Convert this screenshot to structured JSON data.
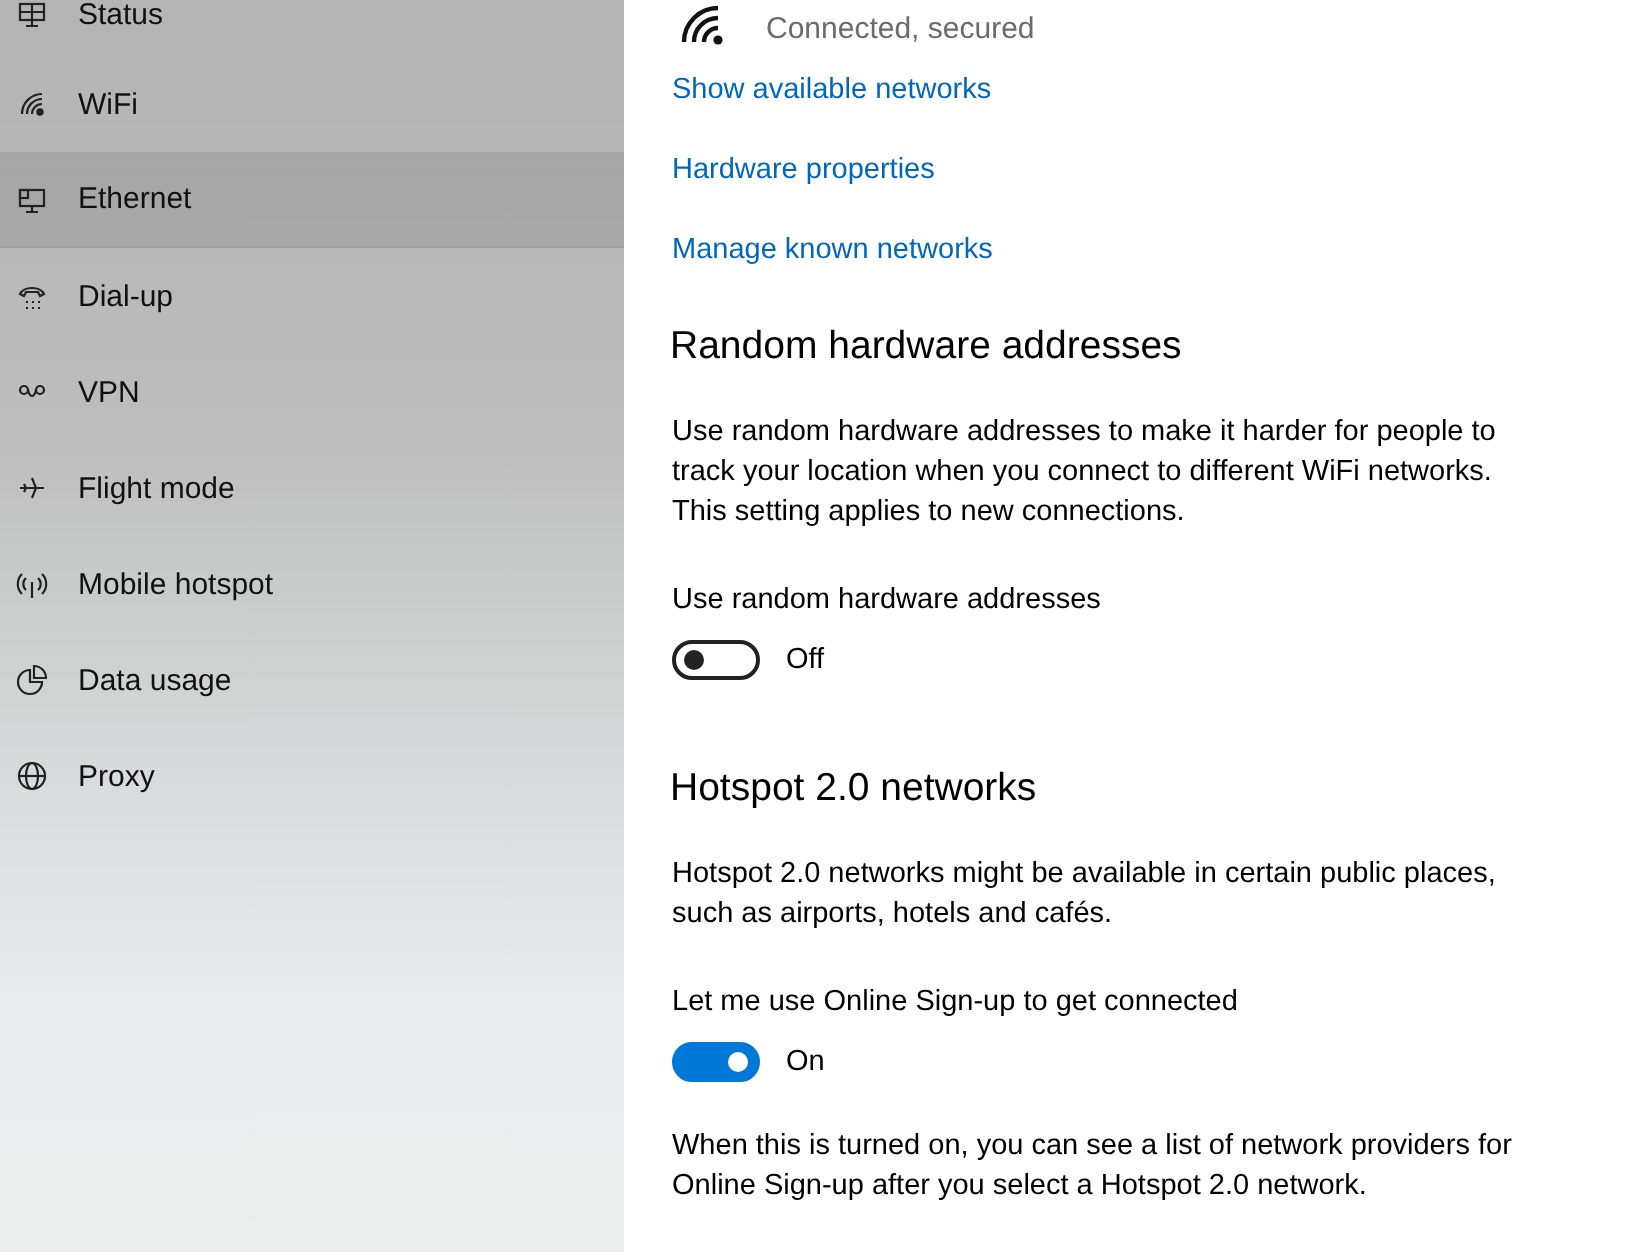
{
  "sidebar": {
    "items": [
      {
        "label": "Status",
        "kind": "status",
        "selected": false
      },
      {
        "label": "WiFi",
        "kind": "wifi",
        "selected": false
      },
      {
        "label": "Ethernet",
        "kind": "ethernet",
        "selected": true
      },
      {
        "label": "Dial-up",
        "kind": "dialup",
        "selected": false
      },
      {
        "label": "VPN",
        "kind": "vpn",
        "selected": false
      },
      {
        "label": "Flight mode",
        "kind": "flight",
        "selected": false
      },
      {
        "label": "Mobile hotspot",
        "kind": "hotspot",
        "selected": false
      },
      {
        "label": "Data usage",
        "kind": "data",
        "selected": false
      },
      {
        "label": "Proxy",
        "kind": "proxy",
        "selected": false
      }
    ]
  },
  "connection": {
    "status": "Connected, secured"
  },
  "links": [
    "Show available networks",
    "Hardware properties",
    "Manage known networks"
  ],
  "sections": [
    {
      "heading": "Random hardware addresses",
      "description": "Use random hardware addresses to make it harder for people to track your location when you connect to different WiFi networks. This setting applies to new connections.",
      "setting_label": "Use random hardware addresses",
      "toggle": {
        "on": false,
        "state_text": "Off"
      }
    },
    {
      "heading": "Hotspot 2.0 networks",
      "description": "Hotspot 2.0 networks might be available in certain public places, such as airports, hotels and cafés.",
      "setting_label": "Let me use Online Sign-up to get connected",
      "toggle": {
        "on": true,
        "state_text": "On"
      },
      "note": "When this is turned on, you can see a list of network providers for Online Sign-up after you select a Hotspot 2.0 network."
    }
  ]
}
